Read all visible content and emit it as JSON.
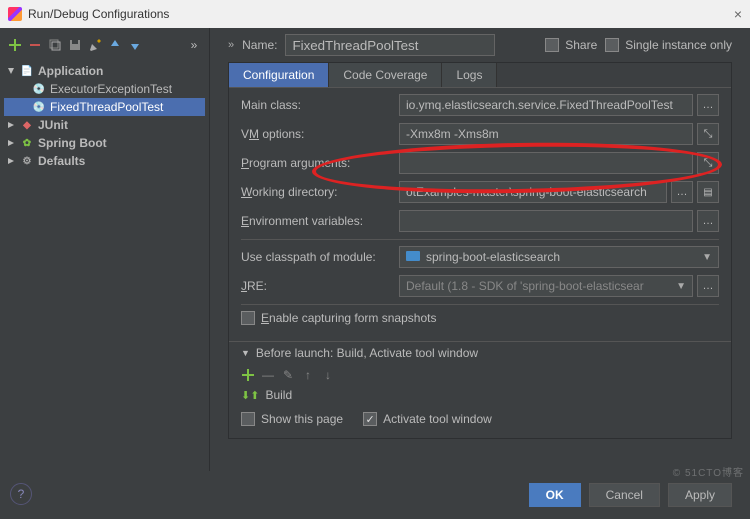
{
  "title": "Run/Debug Configurations",
  "toolbar": {
    "icons": [
      "add",
      "remove",
      "copy",
      "save",
      "edit",
      "up",
      "down",
      "chevrons"
    ]
  },
  "tree": {
    "app": {
      "label": "Application",
      "expanded": true,
      "items": [
        "ExecutorExceptionTest",
        "FixedThreadPoolTest"
      ],
      "selected": "FixedThreadPoolTest"
    },
    "junit": {
      "label": "JUnit"
    },
    "spring": {
      "label": "Spring Boot"
    },
    "defaults": {
      "label": "Defaults"
    }
  },
  "name_label": "Name:",
  "name_value": "FixedThreadPoolTest",
  "share_label": "Share",
  "single_instance_label": "Single instance only",
  "tabs": {
    "config": "Configuration",
    "coverage": "Code Coverage",
    "logs": "Logs"
  },
  "form": {
    "main_class": {
      "label": "Main class:",
      "value": "io.ymq.elasticsearch.service.FixedThreadPoolTest"
    },
    "vm_options": {
      "label_pre": "V",
      "label_ul": "M",
      "label_post": " options:",
      "value": "-Xmx8m -Xms8m"
    },
    "program_args": {
      "label_pre": "",
      "label_ul": "P",
      "label_post": "rogram arguments:",
      "value": ""
    },
    "working_dir": {
      "label_pre": "",
      "label_ul": "W",
      "label_post": "orking directory:",
      "value": "otExamples-master\\spring-boot-elasticsearch"
    },
    "env_vars": {
      "label_pre": "",
      "label_ul": "E",
      "label_post": "nvironment variables:",
      "value": ""
    },
    "classpath": {
      "label": "Use classpath of module:",
      "value": "spring-boot-elasticsearch"
    },
    "jre": {
      "label_pre": "",
      "label_ul": "J",
      "label_post": "RE:",
      "value": "Default (1.8 - SDK of 'spring-boot-elasticsear"
    },
    "snapshots": {
      "label_pre": "",
      "label_ul": "E",
      "label_post": "nable capturing form snapshots",
      "checked": false
    }
  },
  "before_launch": {
    "header": "Before launch: Build, Activate tool window",
    "build": "Build",
    "show_page": "Show this page",
    "activate": "Activate tool window"
  },
  "buttons": {
    "ok": "OK",
    "cancel": "Cancel",
    "apply": "Apply"
  },
  "watermark": "© 51CTO博客"
}
